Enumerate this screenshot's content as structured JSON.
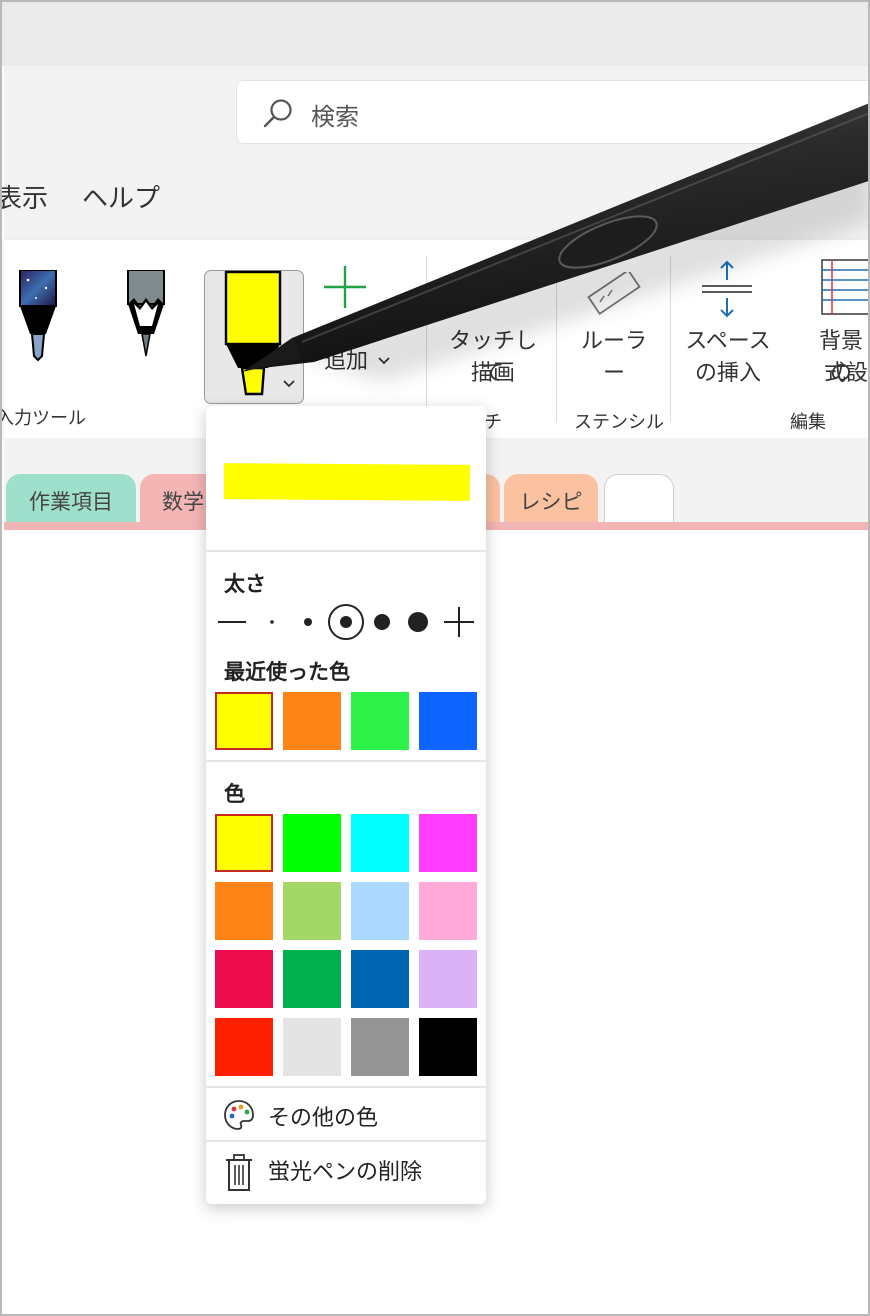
{
  "search": {
    "placeholder": "検索"
  },
  "menu": {
    "items": [
      "表示",
      "ヘルプ"
    ]
  },
  "ribbon": {
    "group_input_tools": "入力ツール",
    "add_pen_label": "追加",
    "touch_draw_line1": "タッチして",
    "touch_draw_line2": "描画",
    "group_touch": "タッチ",
    "ruler_label": "ルーラー",
    "group_stencil": "ステンシル",
    "space_line1": "スペース",
    "space_line2": "の挿入",
    "background_line1": "背景の",
    "background_line2": "式設",
    "group_edit": "編集"
  },
  "tabs": [
    {
      "label": "作業項目",
      "color": "#9fe0cc"
    },
    {
      "label": "数学",
      "color": "#f4b5b5"
    },
    {
      "label": "レシピ",
      "color": "#fbc2a2"
    },
    {
      "label": "",
      "color": "#ffffff"
    }
  ],
  "dropdown": {
    "preview_color": "#ffff00",
    "thickness_title": "太さ",
    "selected_thickness_index": 3,
    "recent_title": "最近使った色",
    "recent_colors": [
      "#ffff00",
      "#ff8418",
      "#2ef24a",
      "#0e64ff"
    ],
    "colors_title": "色",
    "colors": [
      "#ffff00",
      "#00ff00",
      "#00ffff",
      "#ff3cff",
      "#ff8418",
      "#a4d866",
      "#aad8ff",
      "#ffaad8",
      "#ee0c4e",
      "#00b14d",
      "#0066b3",
      "#dab2f8",
      "#ff2000",
      "#e4e4e4",
      "#959595",
      "#000000"
    ],
    "more_colors_label": "その他の色",
    "delete_label": "蛍光ペンの削除"
  },
  "accent": {
    "selected_outline": "#c42b1c",
    "icon_blue": "#1e6fb8"
  }
}
